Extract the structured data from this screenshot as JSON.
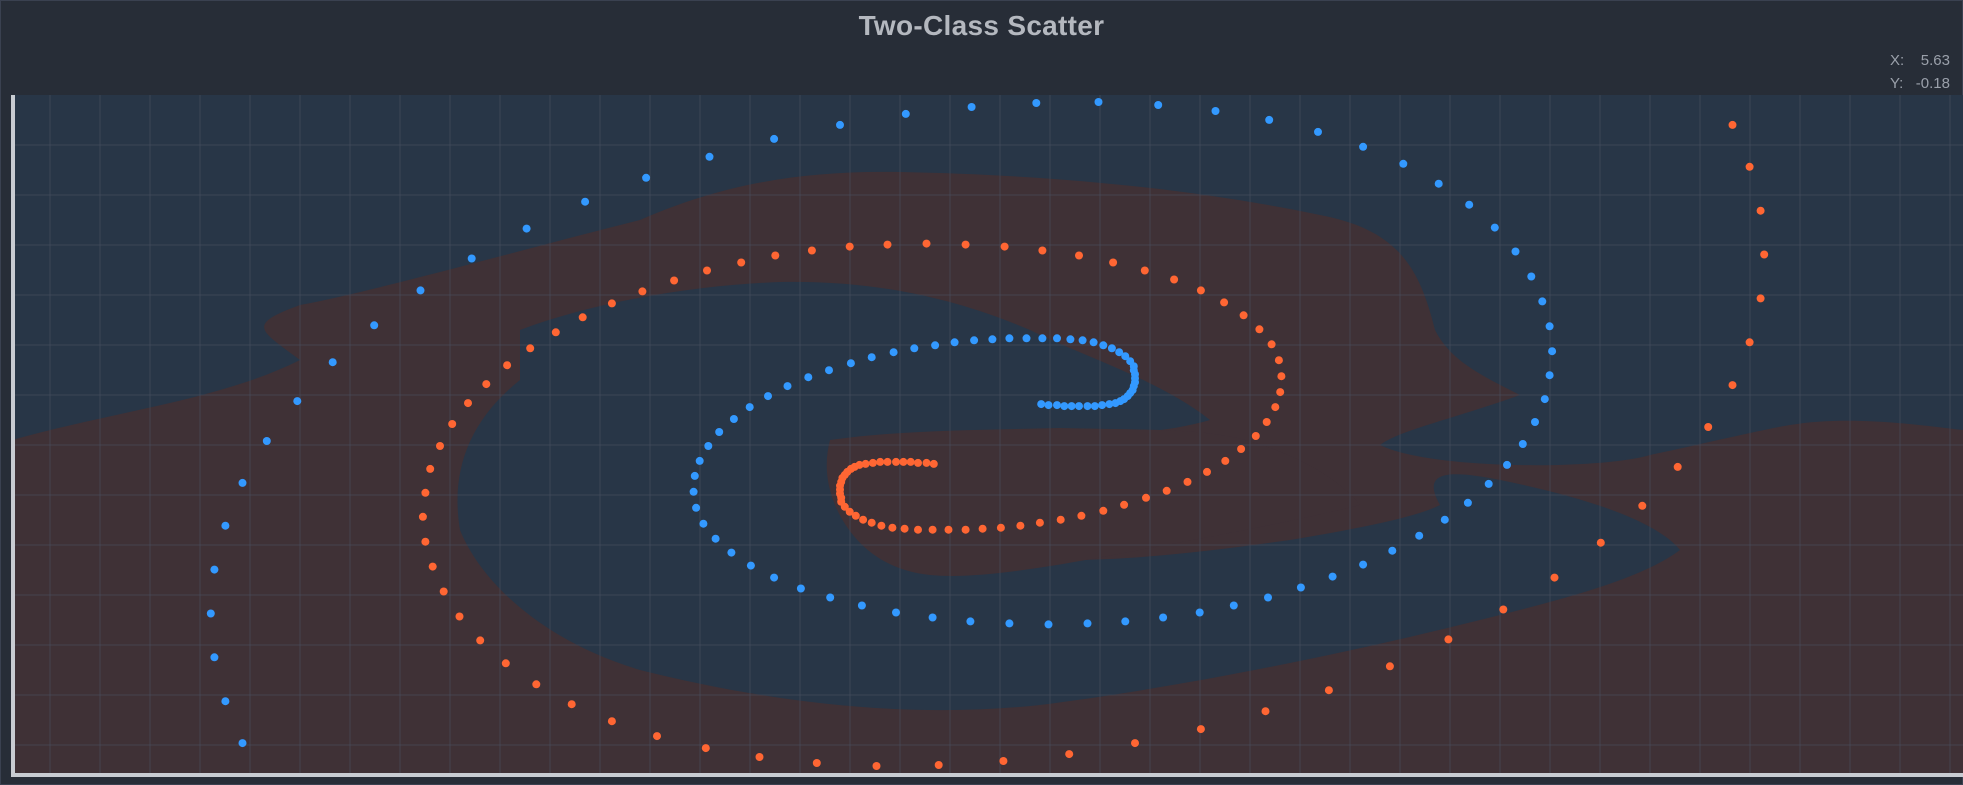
{
  "window": {
    "title": "Two-Class Scatter"
  },
  "cursor_readout": {
    "x_label": "X:",
    "x_value": "5.63",
    "y_label": "Y:",
    "y_value": "-0.18"
  },
  "colors": {
    "background": "#262c36",
    "class_a": "#3399ff",
    "class_b": "#ff6633",
    "region_a": "#283647",
    "region_b": "#3f3136",
    "grid": "#4a5262",
    "axis": "#c8ccd2"
  },
  "chart_data": {
    "type": "scatter",
    "title": "Two-Class Scatter",
    "xlabel": "",
    "ylabel": "",
    "xlim": [
      -8,
      8
    ],
    "ylim": [
      -3.4,
      3.4
    ],
    "grid": true,
    "legend": "none",
    "decision_regions": true,
    "series": [
      {
        "class": "a",
        "points": [
          [
            1.2,
            0.64
          ],
          [
            1.21,
            0.6
          ],
          [
            1.21,
            0.56
          ],
          [
            1.21,
            0.52
          ],
          [
            1.2,
            0.48
          ],
          [
            1.19,
            0.44
          ],
          [
            1.17,
            0.41
          ],
          [
            1.15,
            0.38
          ],
          [
            1.12,
            0.35
          ],
          [
            1.09,
            0.33
          ],
          [
            1.05,
            0.31
          ],
          [
            1.0,
            0.3
          ],
          [
            0.94,
            0.29
          ],
          [
            0.88,
            0.28
          ],
          [
            0.82,
            0.28
          ],
          [
            0.75,
            0.28
          ],
          [
            0.69,
            0.28
          ],
          [
            0.63,
            0.28
          ],
          [
            1.2,
            0.68
          ],
          [
            1.17,
            0.73
          ],
          [
            1.13,
            0.78
          ],
          [
            1.08,
            0.82
          ],
          [
            1.02,
            0.86
          ],
          [
            0.95,
            0.89
          ],
          [
            0.87,
            0.92
          ],
          [
            0.78,
            0.94
          ],
          [
            0.68,
            0.95
          ],
          [
            0.57,
            0.96
          ],
          [
            0.45,
            0.96
          ],
          [
            0.32,
            0.96
          ],
          [
            0.18,
            0.96
          ],
          [
            0.04,
            0.95
          ],
          [
            -0.11,
            0.94
          ],
          [
            -0.27,
            0.92
          ],
          [
            -0.43,
            0.89
          ],
          [
            -0.6,
            0.86
          ],
          [
            -0.77,
            0.82
          ],
          [
            -0.95,
            0.77
          ],
          [
            -1.12,
            0.71
          ],
          [
            -1.3,
            0.64
          ],
          [
            -1.47,
            0.57
          ],
          [
            -1.64,
            0.48
          ],
          [
            -1.8,
            0.38
          ],
          [
            -1.95,
            0.27
          ],
          [
            -2.08,
            0.15
          ],
          [
            -2.2,
            0.02
          ],
          [
            -2.29,
            -0.12
          ],
          [
            -2.36,
            -0.27
          ],
          [
            -2.4,
            -0.42
          ],
          [
            -2.41,
            -0.58
          ],
          [
            -2.39,
            -0.74
          ],
          [
            -2.33,
            -0.9
          ],
          [
            -2.23,
            -1.05
          ],
          [
            -2.1,
            -1.19
          ],
          [
            -1.94,
            -1.32
          ],
          [
            -1.75,
            -1.44
          ],
          [
            -1.53,
            -1.55
          ],
          [
            -1.29,
            -1.64
          ],
          [
            -1.03,
            -1.72
          ],
          [
            -0.75,
            -1.79
          ],
          [
            -0.45,
            -1.84
          ],
          [
            -0.14,
            -1.88
          ],
          [
            0.18,
            -1.9
          ],
          [
            0.5,
            -1.91
          ],
          [
            0.82,
            -1.9
          ],
          [
            1.13,
            -1.88
          ],
          [
            1.44,
            -1.84
          ],
          [
            1.74,
            -1.79
          ],
          [
            2.02,
            -1.72
          ],
          [
            2.3,
            -1.64
          ],
          [
            2.57,
            -1.54
          ],
          [
            2.83,
            -1.43
          ],
          [
            3.08,
            -1.31
          ],
          [
            3.32,
            -1.17
          ],
          [
            3.54,
            -1.02
          ],
          [
            3.75,
            -0.86
          ],
          [
            3.94,
            -0.69
          ],
          [
            4.11,
            -0.5
          ],
          [
            4.26,
            -0.31
          ],
          [
            4.39,
            -0.1
          ],
          [
            4.49,
            0.12
          ],
          [
            4.57,
            0.35
          ],
          [
            4.61,
            0.59
          ],
          [
            4.63,
            0.83
          ],
          [
            4.61,
            1.08
          ],
          [
            4.55,
            1.33
          ],
          [
            4.46,
            1.58
          ],
          [
            4.33,
            1.83
          ],
          [
            4.16,
            2.07
          ],
          [
            3.95,
            2.3
          ],
          [
            3.7,
            2.51
          ],
          [
            3.41,
            2.71
          ],
          [
            3.08,
            2.88
          ],
          [
            2.71,
            3.03
          ],
          [
            2.31,
            3.15
          ],
          [
            1.87,
            3.24
          ],
          [
            1.4,
            3.3
          ],
          [
            0.91,
            3.33
          ],
          [
            0.4,
            3.32
          ],
          [
            -0.13,
            3.28
          ],
          [
            -0.67,
            3.21
          ],
          [
            -1.21,
            3.1
          ],
          [
            -1.75,
            2.96
          ],
          [
            -2.28,
            2.78
          ],
          [
            -2.8,
            2.57
          ],
          [
            -3.3,
            2.33
          ],
          [
            -3.78,
            2.06
          ],
          [
            -4.23,
            1.76
          ],
          [
            -4.65,
            1.44
          ],
          [
            -5.03,
            1.09
          ],
          [
            -5.37,
            0.72
          ],
          [
            -5.66,
            0.33
          ],
          [
            -5.91,
            -0.07
          ],
          [
            -6.11,
            -0.49
          ],
          [
            -6.25,
            -0.92
          ],
          [
            -6.34,
            -1.36
          ],
          [
            -6.37,
            -1.8
          ],
          [
            -6.34,
            -2.24
          ],
          [
            -6.25,
            -2.68
          ],
          [
            -6.11,
            -3.1
          ],
          [
            0.57,
            0.29
          ],
          [
            0.5,
            0.29
          ],
          [
            0.44,
            0.3
          ]
        ]
      },
      {
        "class": "b",
        "points": [
          [
            -1.2,
            -0.64
          ],
          [
            -1.21,
            -0.6
          ],
          [
            -1.21,
            -0.56
          ],
          [
            -1.21,
            -0.52
          ],
          [
            -1.2,
            -0.48
          ],
          [
            -1.19,
            -0.44
          ],
          [
            -1.17,
            -0.41
          ],
          [
            -1.15,
            -0.38
          ],
          [
            -1.12,
            -0.35
          ],
          [
            -1.09,
            -0.33
          ],
          [
            -1.05,
            -0.31
          ],
          [
            -1.0,
            -0.3
          ],
          [
            -0.94,
            -0.29
          ],
          [
            -0.88,
            -0.28
          ],
          [
            -0.82,
            -0.28
          ],
          [
            -0.75,
            -0.28
          ],
          [
            -0.69,
            -0.28
          ],
          [
            -0.63,
            -0.28
          ],
          [
            -1.2,
            -0.68
          ],
          [
            -1.17,
            -0.73
          ],
          [
            -1.13,
            -0.78
          ],
          [
            -1.08,
            -0.82
          ],
          [
            -1.02,
            -0.86
          ],
          [
            -0.95,
            -0.89
          ],
          [
            -0.87,
            -0.92
          ],
          [
            -0.78,
            -0.94
          ],
          [
            -0.68,
            -0.95
          ],
          [
            -0.57,
            -0.96
          ],
          [
            -0.45,
            -0.96
          ],
          [
            -0.32,
            -0.96
          ],
          [
            -0.18,
            -0.96
          ],
          [
            -0.04,
            -0.95
          ],
          [
            0.11,
            -0.94
          ],
          [
            0.27,
            -0.92
          ],
          [
            0.43,
            -0.89
          ],
          [
            0.6,
            -0.86
          ],
          [
            0.77,
            -0.82
          ],
          [
            0.95,
            -0.77
          ],
          [
            1.12,
            -0.71
          ],
          [
            1.3,
            -0.64
          ],
          [
            1.47,
            -0.57
          ],
          [
            1.64,
            -0.48
          ],
          [
            1.8,
            -0.38
          ],
          [
            1.95,
            -0.27
          ],
          [
            2.08,
            -0.15
          ],
          [
            2.2,
            -0.02
          ],
          [
            2.29,
            0.12
          ],
          [
            2.36,
            0.27
          ],
          [
            2.4,
            0.42
          ],
          [
            2.41,
            0.58
          ],
          [
            2.39,
            0.74
          ],
          [
            2.33,
            0.9
          ],
          [
            2.23,
            1.05
          ],
          [
            2.1,
            1.19
          ],
          [
            1.94,
            1.32
          ],
          [
            1.75,
            1.44
          ],
          [
            1.53,
            1.55
          ],
          [
            1.29,
            1.64
          ],
          [
            1.03,
            1.72
          ],
          [
            0.75,
            1.79
          ],
          [
            0.45,
            1.84
          ],
          [
            0.14,
            1.88
          ],
          [
            -0.18,
            1.9
          ],
          [
            -0.5,
            1.91
          ],
          [
            -0.82,
            1.9
          ],
          [
            -1.13,
            1.88
          ],
          [
            -1.44,
            1.84
          ],
          [
            -1.74,
            1.79
          ],
          [
            -2.02,
            1.72
          ],
          [
            -2.3,
            1.64
          ],
          [
            -2.57,
            1.54
          ],
          [
            -2.83,
            1.43
          ],
          [
            -3.08,
            1.31
          ],
          [
            -3.32,
            1.17
          ],
          [
            -3.54,
            1.02
          ],
          [
            -3.75,
            0.86
          ],
          [
            -3.94,
            0.69
          ],
          [
            -4.11,
            0.5
          ],
          [
            -4.26,
            0.31
          ],
          [
            -4.39,
            0.1
          ],
          [
            -4.49,
            -0.12
          ],
          [
            -4.57,
            -0.35
          ],
          [
            -4.61,
            -0.59
          ],
          [
            -4.63,
            -0.83
          ],
          [
            -4.61,
            -1.08
          ],
          [
            -4.55,
            -1.33
          ],
          [
            -4.46,
            -1.58
          ],
          [
            -4.33,
            -1.83
          ],
          [
            -4.16,
            -2.07
          ],
          [
            -3.95,
            -2.3
          ],
          [
            -3.7,
            -2.51
          ],
          [
            -3.41,
            -2.71
          ],
          [
            -3.08,
            -2.88
          ],
          [
            -2.71,
            -3.03
          ],
          [
            -2.31,
            -3.15
          ],
          [
            -1.87,
            -3.24
          ],
          [
            -1.4,
            -3.3
          ],
          [
            -0.91,
            -3.33
          ],
          [
            -0.4,
            -3.32
          ],
          [
            0.13,
            -3.28
          ],
          [
            0.67,
            -3.21
          ],
          [
            1.21,
            -3.1
          ],
          [
            1.75,
            -2.96
          ],
          [
            2.28,
            -2.78
          ],
          [
            2.8,
            -2.57
          ],
          [
            3.3,
            -2.33
          ],
          [
            3.78,
            -2.06
          ],
          [
            4.23,
            -1.76
          ],
          [
            4.65,
            -1.44
          ],
          [
            5.03,
            -1.09
          ],
          [
            5.37,
            -0.72
          ],
          [
            5.66,
            -0.33
          ],
          [
            5.91,
            0.07
          ],
          [
            6.11,
            0.49
          ],
          [
            6.25,
            0.92
          ],
          [
            6.34,
            1.36
          ],
          [
            6.37,
            1.8
          ],
          [
            6.34,
            2.24
          ],
          [
            6.25,
            2.68
          ],
          [
            6.11,
            3.1
          ],
          [
            -0.57,
            -0.29
          ],
          [
            -0.5,
            -0.29
          ],
          [
            -0.44,
            -0.3
          ]
        ]
      }
    ]
  }
}
